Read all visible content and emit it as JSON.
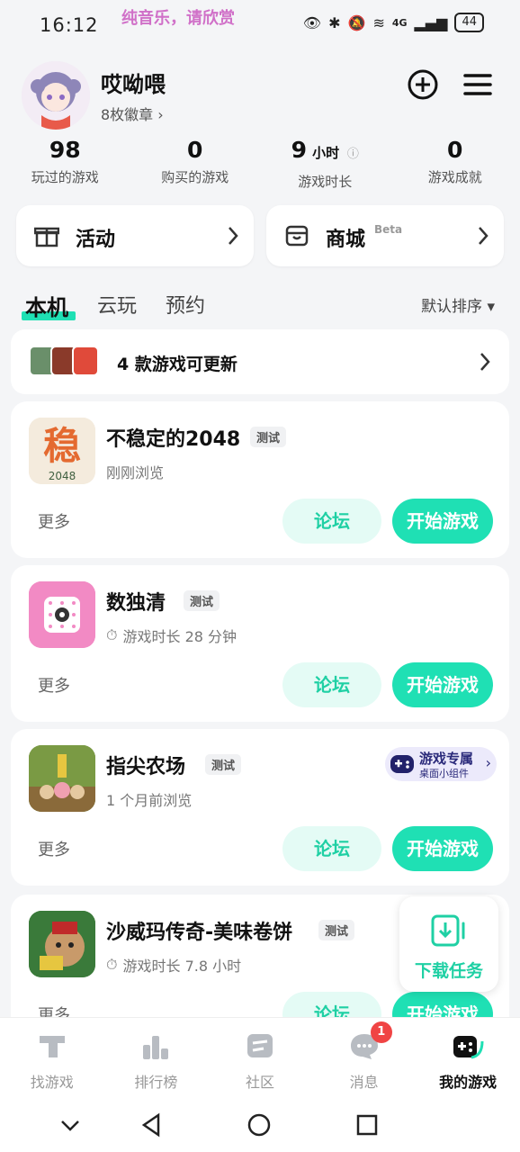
{
  "status_bar": {
    "time": "16:12",
    "media_text": "纯音乐，请欣赏",
    "network": "4G",
    "battery": "44"
  },
  "profile": {
    "nickname": "哎呦喂",
    "badges": "8枚徽章 ›"
  },
  "stats": [
    {
      "value": "98",
      "unit": "",
      "label": "玩过的游戏"
    },
    {
      "value": "0",
      "unit": "",
      "label": "购买的游戏"
    },
    {
      "value": "9",
      "unit": "小时",
      "label": "游戏时长"
    },
    {
      "value": "0",
      "unit": "",
      "label": "游戏成就"
    }
  ],
  "quick": {
    "activity": "活动",
    "mall": "商城",
    "mall_badge": "Beta"
  },
  "tabs": [
    "本机",
    "云玩",
    "预约"
  ],
  "sort_label": "默认排序 ▾",
  "update_banner": "4 款游戏可更新",
  "games": [
    {
      "title": "不稳定的2048",
      "tag": "测试",
      "sub": "刚刚浏览",
      "icon_char": "稳",
      "icon_sub": "2048"
    },
    {
      "title": "数独清",
      "tag": "测试",
      "sub": "游戏时长 28 分钟"
    },
    {
      "title": "指尖农场",
      "tag": "测试",
      "sub": "1 个月前浏览"
    },
    {
      "title": "沙威玛传奇-美味卷饼",
      "tag": "测试",
      "sub": "游戏时长 7.8 小时"
    }
  ],
  "game_actions": {
    "more": "更多",
    "forum": "论坛",
    "start": "开始游戏"
  },
  "widget_promo": {
    "title": "游戏专属",
    "subtitle": "桌面小组件"
  },
  "download_task": "下载任务",
  "bottom_nav": [
    {
      "label": "找游戏",
      "icon": "tap-logo-icon"
    },
    {
      "label": "排行榜",
      "icon": "ranking-icon"
    },
    {
      "label": "社区",
      "icon": "community-icon"
    },
    {
      "label": "消息",
      "icon": "message-icon",
      "badge": "1"
    },
    {
      "label": "我的游戏",
      "icon": "gamepad-icon"
    }
  ],
  "colors": {
    "accent": "#1fe0b4",
    "accent_light": "#e4fbf5",
    "badge_red": "#f04444"
  }
}
